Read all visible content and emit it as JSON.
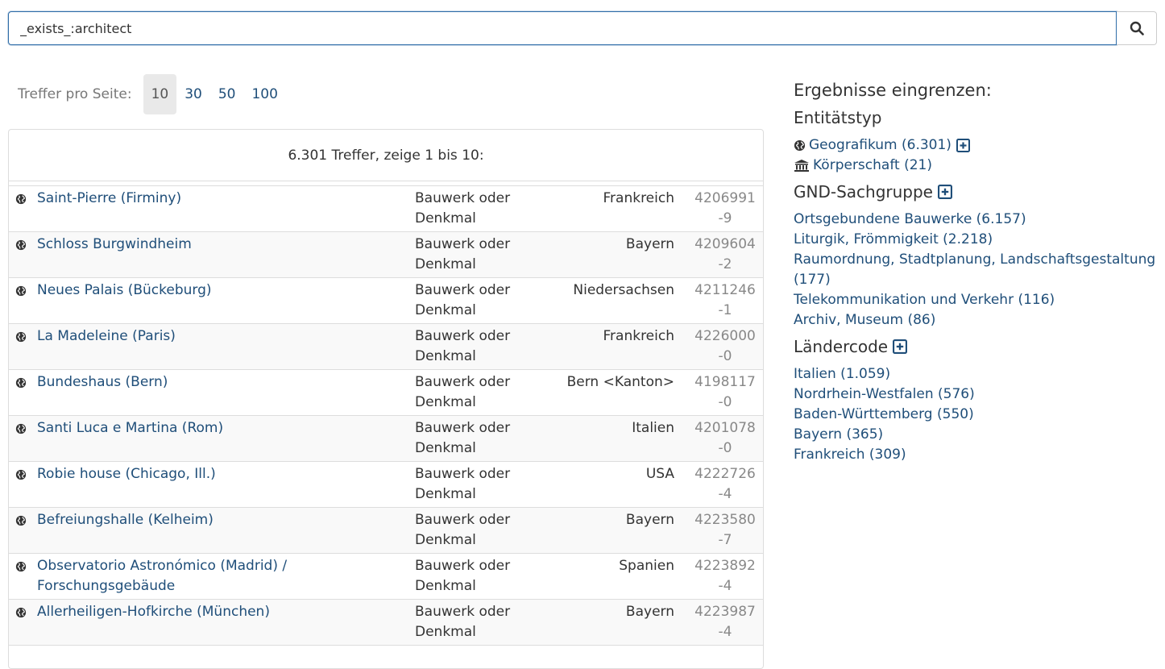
{
  "search": {
    "value": "_exists_:architect"
  },
  "per_page": {
    "label": "Treffer pro Seite:",
    "options": [
      "10",
      "30",
      "50",
      "100"
    ],
    "active": "10"
  },
  "results": {
    "summary": "6.301 Treffer, zeige 1 bis 10:",
    "rows": [
      {
        "title": "Saint-Pierre (Firminy)",
        "type": "Bauwerk oder Denkmal",
        "place": "Frankreich",
        "id": "4206991-9"
      },
      {
        "title": "Schloss Burgwindheim",
        "type": "Bauwerk oder Denkmal",
        "place": "Bayern",
        "id": "4209604-2"
      },
      {
        "title": "Neues Palais (Bückeburg)",
        "type": "Bauwerk oder Denkmal",
        "place": "Niedersachsen",
        "id": "4211246-1"
      },
      {
        "title": "La Madeleine (Paris)",
        "type": "Bauwerk oder Denkmal",
        "place": "Frankreich",
        "id": "4226000-0"
      },
      {
        "title": "Bundeshaus (Bern)",
        "type": "Bauwerk oder Denkmal",
        "place": "Bern <Kanton>",
        "id": "4198117-0"
      },
      {
        "title": "Santi Luca e Martina (Rom)",
        "type": "Bauwerk oder Denkmal",
        "place": "Italien",
        "id": "4201078-0"
      },
      {
        "title": "Robie house (Chicago, Ill.)",
        "type": "Bauwerk oder Denkmal",
        "place": "USA",
        "id": "4222726-4"
      },
      {
        "title": "Befreiungshalle (Kelheim)",
        "type": "Bauwerk oder Denkmal",
        "place": "Bayern",
        "id": "4223580-7"
      },
      {
        "title": "Observatorio Astronómico (Madrid) / Forschungsgebäude",
        "type": "Bauwerk oder Denkmal",
        "place": "Spanien",
        "id": "4223892-4"
      },
      {
        "title": "Allerheiligen-Hofkirche (München)",
        "type": "Bauwerk oder Denkmal",
        "place": "Bayern",
        "id": "4223987-4"
      }
    ]
  },
  "sidebar": {
    "heading": "Ergebnisse eingrenzen:",
    "entity": {
      "title": "Entitätstyp",
      "items": [
        {
          "label": "Geografikum (6.301)",
          "icon": "globe-icon"
        },
        {
          "label": "Körperschaft (21)",
          "icon": "institution-icon"
        }
      ]
    },
    "gnd": {
      "title": "GND-Sachgruppe",
      "items": [
        "Ortsgebundene Bauwerke (6.157)",
        "Liturgik, Frömmigkeit (2.218)",
        "Raumordnung, Stadtplanung, Landschaftsgestaltung (177)",
        "Telekommunikation und Verkehr (116)",
        "Archiv, Museum (86)"
      ]
    },
    "country": {
      "title": "Ländercode",
      "items": [
        "Italien (1.059)",
        "Nordrhein-Westfalen (576)",
        "Baden-Württemberg (550)",
        "Bayern (365)",
        "Frankreich (309)"
      ]
    }
  },
  "colors": {
    "link": "#1f4e79",
    "text": "#333333",
    "muted": "#888888",
    "border": "#dddddd",
    "focus": "#2f6da8"
  }
}
